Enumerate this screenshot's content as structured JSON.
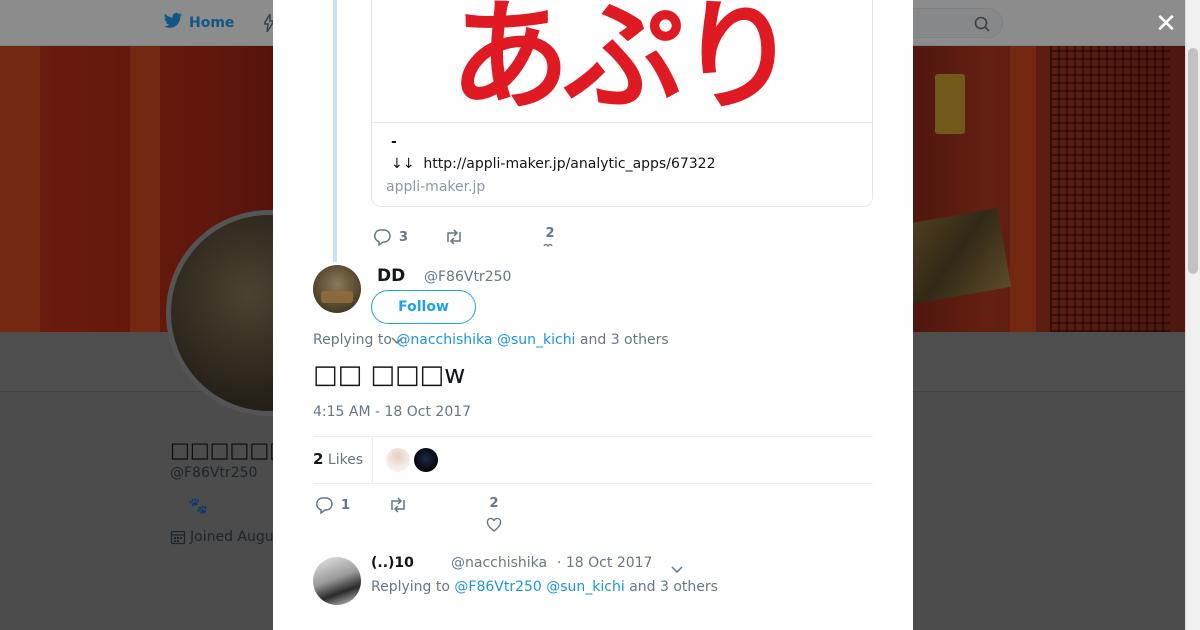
{
  "navbar": {
    "home_label": "Home",
    "brand_color": "#1da1f2"
  },
  "profile": {
    "name": "□□□□□□ DD",
    "handle": "@F86Vtr250",
    "emoji": "🐾",
    "joined": "Joined Augu"
  },
  "modal": {
    "close_symbol": "✕",
    "card": {
      "image_text": "あぷり",
      "desc_line1": "-",
      "arrows": "↓↓",
      "url": "http://appli-maker.jp/analytic_apps/67322",
      "domain": "appli-maker.jp"
    },
    "parent_actions": {
      "reply_count": "3",
      "retweet_count": "",
      "like_count": "2"
    },
    "tweet": {
      "name": "DD",
      "handle": "@F86Vtr250",
      "follow_label": "Follow",
      "replying_prefix": "Replying to",
      "replying_user1": "@nacchishika",
      "replying_user2": "@sun_kichi",
      "replying_suffix": "and 3 others",
      "text": "□□ □□□w",
      "timestamp": "4:15 AM - 18 Oct 2017",
      "likes_count": "2",
      "likes_label": "Likes",
      "actions": {
        "reply_count": "1",
        "like_count": "2"
      }
    },
    "reply": {
      "name": "(..)10",
      "handle": "@nacchishika",
      "date": "· 18 Oct 2017",
      "replying_prefix": "Replying to",
      "replying_user1": "@F86Vtr250",
      "replying_user2": "@sun_kichi",
      "replying_suffix": "and 3 others"
    }
  }
}
